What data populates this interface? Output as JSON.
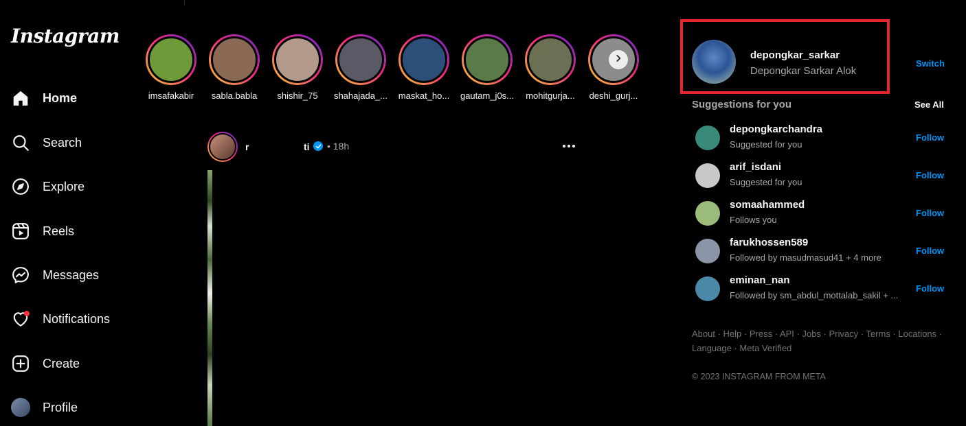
{
  "app": {
    "logo_text": "Instagram"
  },
  "nav": [
    {
      "label": "Home",
      "icon": "home-icon",
      "active": true
    },
    {
      "label": "Search",
      "icon": "search-icon"
    },
    {
      "label": "Explore",
      "icon": "compass-icon"
    },
    {
      "label": "Reels",
      "icon": "reels-icon"
    },
    {
      "label": "Messages",
      "icon": "messenger-icon"
    },
    {
      "label": "Notifications",
      "icon": "heart-icon",
      "has_dot": true
    },
    {
      "label": "Create",
      "icon": "plus-square-icon"
    },
    {
      "label": "Profile",
      "icon": "avatar"
    }
  ],
  "stories": [
    {
      "name": "imsafakabir",
      "color": "#6f9a3a"
    },
    {
      "name": "sabla.babla",
      "color": "#8a6a55"
    },
    {
      "name": "shishir_75",
      "color": "#b39a8a"
    },
    {
      "name": "shahajada_...",
      "color": "#5a5a66"
    },
    {
      "name": "maskat_ho...",
      "color": "#2c4f7a"
    },
    {
      "name": "gautam_j0s...",
      "color": "#5a7a4a"
    },
    {
      "name": "mohitgurja...",
      "color": "#6b7055"
    },
    {
      "name": "deshi_gurj...",
      "color": "#8c8c8c"
    }
  ],
  "post": {
    "username_part1": "r",
    "username_part2": "ti",
    "time": "• 18h"
  },
  "current_user": {
    "username": "depongkar_sarkar",
    "full_name": "Depongkar Sarkar Alok",
    "switch_label": "Switch"
  },
  "suggestions": {
    "title": "Suggestions for you",
    "see_all": "See All",
    "follow_label": "Follow",
    "items": [
      {
        "username": "depongkarchandra",
        "subtitle": "Suggested for you",
        "color": "#3a8a7a"
      },
      {
        "username": "arif_isdani",
        "subtitle": "Suggested for you",
        "color": "#c8c8c8"
      },
      {
        "username": "somaahammed",
        "subtitle": "Follows you",
        "color": "#9bbb7a"
      },
      {
        "username": "farukhossen589",
        "subtitle": "Followed by masudmasud41 + 4 more",
        "color": "#8a96a8"
      },
      {
        "username": "eminan_nan",
        "subtitle": "Followed by sm_abdul_mottalab_sakil + ...",
        "color": "#4a8aa8"
      }
    ]
  },
  "footer": {
    "links": [
      "About",
      "Help",
      "Press",
      "API",
      "Jobs",
      "Privacy",
      "Terms",
      "Locations",
      "Language",
      "Meta Verified"
    ],
    "copyright": "© 2023 INSTAGRAM FROM META"
  }
}
